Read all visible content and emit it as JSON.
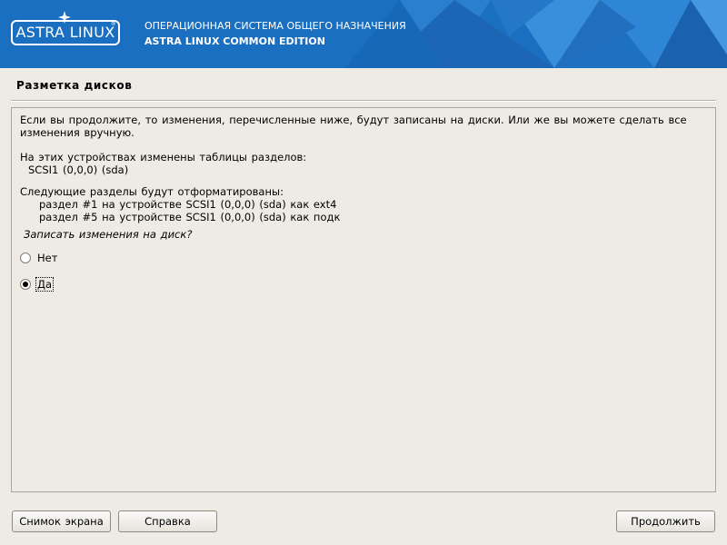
{
  "header": {
    "logo_text": "ASTRA LINUX",
    "logo_mark": "®",
    "title_line1": "ОПЕРАЦИОННАЯ СИСТЕМА ОБЩЕГО НАЗНАЧЕНИЯ",
    "title_line2": "ASTRA LINUX COMMON EDITION",
    "logo_icon": "star-icon",
    "bg_color": "#1a6fc1"
  },
  "page": {
    "title": "Разметка дисков"
  },
  "panel": {
    "intro_line1": "Если вы продолжите, то изменения, перечисленные ниже, будут записаны на диски. Или же вы можете сделать все",
    "intro_line2": "изменения вручную.",
    "tables_heading": "На этих устройствах изменены таблицы разделов:",
    "tables_device": "SCSI1 (0,0,0) (sda)",
    "format_heading": "Следующие разделы будут отформатированы:",
    "format_items": [
      "раздел #1 на устройстве SCSI1 (0,0,0) (sda) как ext4",
      "раздел #5 на устройстве SCSI1 (0,0,0) (sda) как подк"
    ],
    "question": "Записать изменения на диск?",
    "options": [
      {
        "label": "Нет",
        "selected": false
      },
      {
        "label": "Да",
        "selected": true
      }
    ]
  },
  "buttons": {
    "screenshot": "Снимок экрана",
    "help": "Справка",
    "continue": "Продолжить"
  }
}
